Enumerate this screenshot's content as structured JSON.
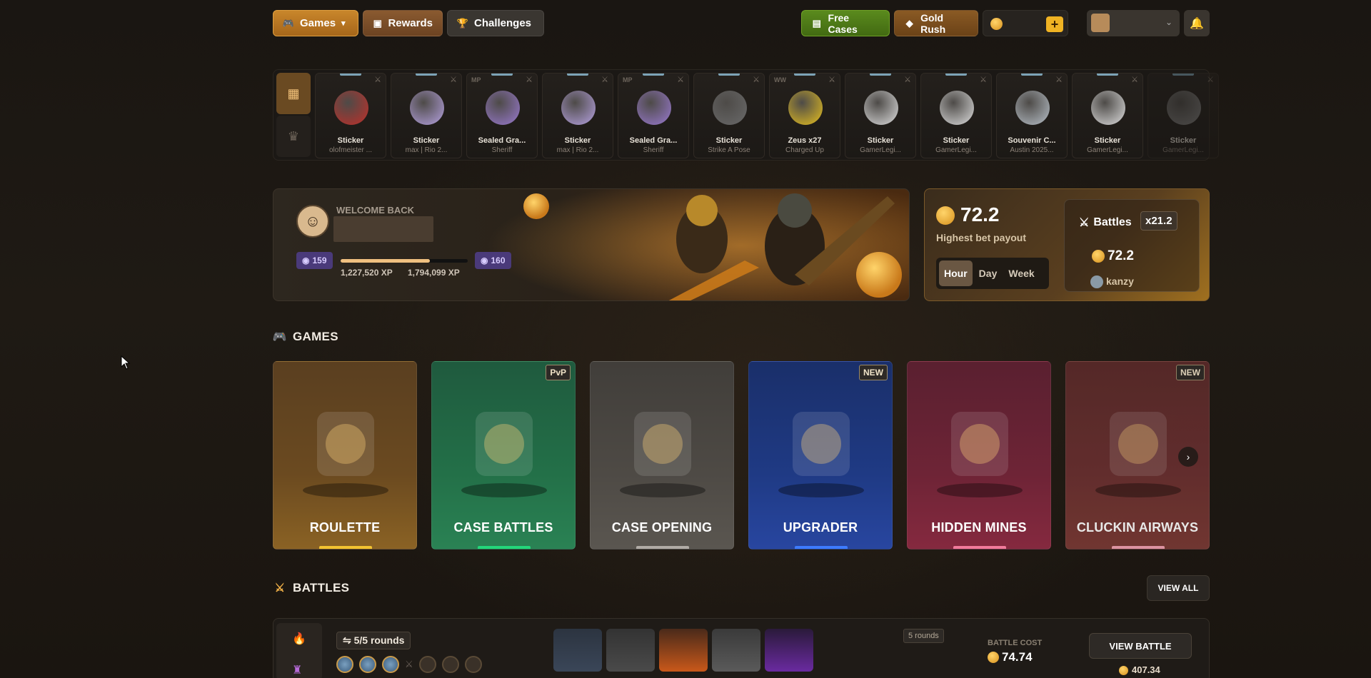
{
  "nav": {
    "games_label": "Games",
    "rewards_label": "Rewards",
    "challenges_label": "Challenges",
    "free_cases_label": "Free Cases",
    "gold_rush_label": "Gold Rush",
    "balance_value": "",
    "plus_label": "+",
    "icons": {
      "games": "gamepad-icon",
      "rewards": "chest-icon",
      "challenges": "trophy-icon",
      "free_cases": "gift-icon",
      "gold_rush": "gold-icon",
      "bell": "bell-icon"
    }
  },
  "drops": {
    "items": [
      {
        "tag": "",
        "title": "Sticker",
        "subtitle": "olofmeister ...",
        "color": "#c0302a"
      },
      {
        "tag": "",
        "title": "Sticker",
        "subtitle": "max | Rio 2...",
        "color": "#b6a2e0"
      },
      {
        "tag": "MP",
        "title": "Sealed Gra...",
        "subtitle": "Sheriff",
        "color": "#9a7ad0"
      },
      {
        "tag": "",
        "title": "Sticker",
        "subtitle": "max | Rio 2...",
        "color": "#b6a2e0"
      },
      {
        "tag": "MP",
        "title": "Sealed Gra...",
        "subtitle": "Sheriff",
        "color": "#9a7ad0"
      },
      {
        "tag": "",
        "title": "Sticker",
        "subtitle": "Strike A Pose",
        "color": "#6a6a6a"
      },
      {
        "tag": "WW",
        "title": "Zeus x27",
        "subtitle": "Charged Up",
        "color": "#e6c020"
      },
      {
        "tag": "",
        "title": "Sticker",
        "subtitle": "GamerLegi...",
        "color": "#dddddd"
      },
      {
        "tag": "",
        "title": "Sticker",
        "subtitle": "GamerLegi...",
        "color": "#dddddd"
      },
      {
        "tag": "",
        "title": "Souvenir C...",
        "subtitle": "Austin 2025...",
        "color": "#b8c0c8"
      },
      {
        "tag": "",
        "title": "Sticker",
        "subtitle": "GamerLegi...",
        "color": "#dddddd"
      },
      {
        "tag": "",
        "title": "Sticker",
        "subtitle": "GamerLegi...",
        "color": "#888888"
      }
    ]
  },
  "welcome": {
    "heading": "WELCOME BACK",
    "level_current": "159",
    "level_next": "160",
    "xp_current": "1,227,520 XP",
    "xp_next": "1,794,099 XP",
    "xp_progress": 0.7
  },
  "payout": {
    "amount": "72.2",
    "label": "Highest bet payout",
    "periods": [
      "Hour",
      "Day",
      "Week"
    ],
    "active_period": "Hour",
    "mode": "Battles",
    "multiplier": "x21.2",
    "mode_value": "72.2",
    "player": "kanzy"
  },
  "games_section": {
    "title": "GAMES",
    "cards": [
      {
        "name": "ROULETTE",
        "badge": "",
        "bar": "#f2c230"
      },
      {
        "name": "CASE BATTLES",
        "badge": "PvP",
        "bar": "#23d67a"
      },
      {
        "name": "CASE OPENING",
        "badge": "",
        "bar": "#b0aba5"
      },
      {
        "name": "UPGRADER",
        "badge": "NEW",
        "bar": "#3d7bff"
      },
      {
        "name": "HIDDEN MINES",
        "badge": "",
        "bar": "#f07a9a"
      },
      {
        "name": "CLUCKIN AIRWAYS",
        "badge": "NEW",
        "bar": "#f0a0b0"
      }
    ]
  },
  "battles_section": {
    "title": "BATTLES",
    "view_all": "VIEW ALL",
    "row": {
      "rounds": "5/5 rounds",
      "rounds_tag": "5 rounds",
      "cost_label": "BATTLE COST",
      "cost": "74.74",
      "view_label": "VIEW BATTLE",
      "winnings": "407.34"
    }
  }
}
